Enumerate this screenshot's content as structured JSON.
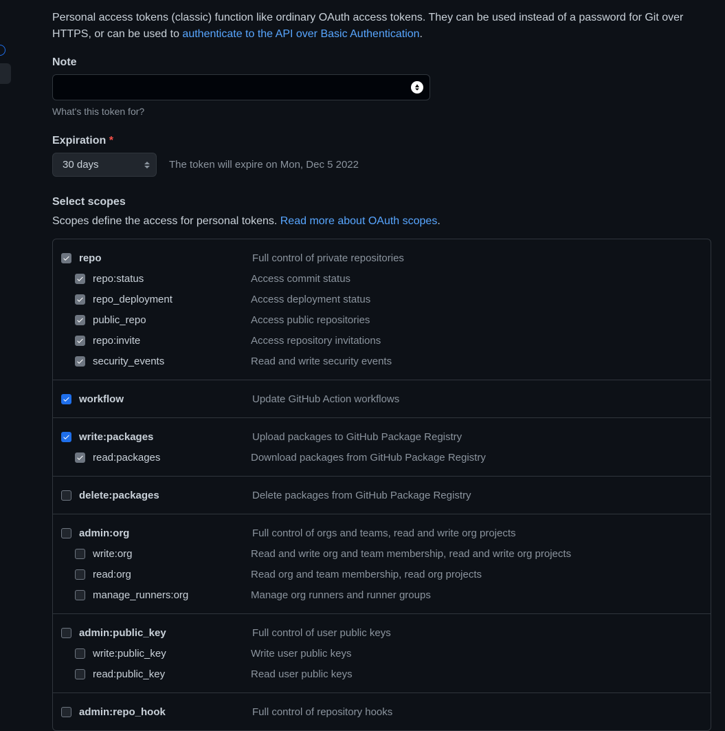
{
  "intro": {
    "text_before": "Personal access tokens (classic) function like ordinary OAuth access tokens. They can be used instead of a password for Git over HTTPS, or can be used to ",
    "link": "authenticate to the API over Basic Authentication",
    "text_after": "."
  },
  "note": {
    "label": "Note",
    "value": "",
    "hint": "What's this token for?"
  },
  "expiration": {
    "label": "Expiration",
    "selected": "30 days",
    "message": "The token will expire on Mon, Dec 5 2022"
  },
  "scopes": {
    "title": "Select scopes",
    "desc_before": "Scopes define the access for personal tokens. ",
    "link": "Read more about OAuth scopes",
    "desc_after": "."
  },
  "groups": [
    {
      "parent": {
        "name": "repo",
        "desc": "Full control of private repositories",
        "state": "grey"
      },
      "children": [
        {
          "name": "repo:status",
          "desc": "Access commit status",
          "state": "grey"
        },
        {
          "name": "repo_deployment",
          "desc": "Access deployment status",
          "state": "grey"
        },
        {
          "name": "public_repo",
          "desc": "Access public repositories",
          "state": "grey"
        },
        {
          "name": "repo:invite",
          "desc": "Access repository invitations",
          "state": "grey"
        },
        {
          "name": "security_events",
          "desc": "Read and write security events",
          "state": "grey"
        }
      ]
    },
    {
      "parent": {
        "name": "workflow",
        "desc": "Update GitHub Action workflows",
        "state": "blue"
      },
      "children": []
    },
    {
      "parent": {
        "name": "write:packages",
        "desc": "Upload packages to GitHub Package Registry",
        "state": "blue"
      },
      "children": [
        {
          "name": "read:packages",
          "desc": "Download packages from GitHub Package Registry",
          "state": "grey"
        }
      ]
    },
    {
      "parent": {
        "name": "delete:packages",
        "desc": "Delete packages from GitHub Package Registry",
        "state": "empty"
      },
      "children": []
    },
    {
      "parent": {
        "name": "admin:org",
        "desc": "Full control of orgs and teams, read and write org projects",
        "state": "empty"
      },
      "children": [
        {
          "name": "write:org",
          "desc": "Read and write org and team membership, read and write org projects",
          "state": "empty"
        },
        {
          "name": "read:org",
          "desc": "Read org and team membership, read org projects",
          "state": "empty"
        },
        {
          "name": "manage_runners:org",
          "desc": "Manage org runners and runner groups",
          "state": "empty"
        }
      ]
    },
    {
      "parent": {
        "name": "admin:public_key",
        "desc": "Full control of user public keys",
        "state": "empty"
      },
      "children": [
        {
          "name": "write:public_key",
          "desc": "Write user public keys",
          "state": "empty"
        },
        {
          "name": "read:public_key",
          "desc": "Read user public keys",
          "state": "empty"
        }
      ]
    },
    {
      "parent": {
        "name": "admin:repo_hook",
        "desc": "Full control of repository hooks",
        "state": "empty"
      },
      "children": []
    }
  ]
}
